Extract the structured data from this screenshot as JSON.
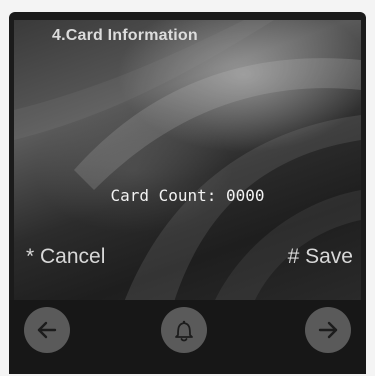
{
  "screen": {
    "title": "4.Card Information",
    "card_count_label": "Card Count: 0000"
  },
  "soft_keys": {
    "cancel": "* Cancel",
    "save": "# Save"
  },
  "nav": {
    "left_icon": "arrow-left-icon",
    "center_icon": "bell-icon",
    "right_icon": "arrow-right-icon"
  }
}
